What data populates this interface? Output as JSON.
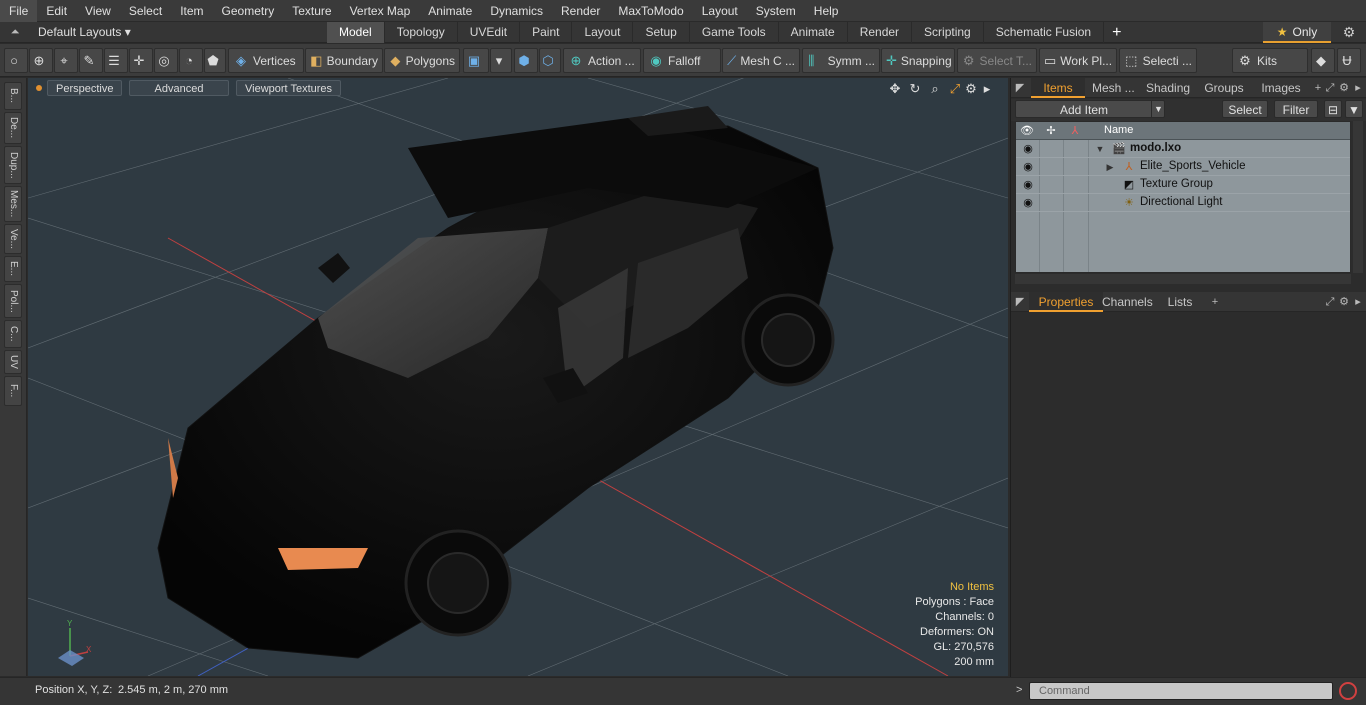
{
  "menu": [
    "File",
    "Edit",
    "View",
    "Select",
    "Item",
    "Geometry",
    "Texture",
    "Vertex Map",
    "Animate",
    "Dynamics",
    "Render",
    "MaxToModo",
    "Layout",
    "System",
    "Help"
  ],
  "layout_select": "Default Layouts ▾",
  "mode_tabs": [
    "Model",
    "Topology",
    "UVEdit",
    "Paint",
    "Layout",
    "Setup",
    "Game Tools",
    "Animate",
    "Render",
    "Scripting",
    "Schematic Fusion"
  ],
  "active_mode_tab": "Model",
  "only_label": "Only",
  "toolbar": {
    "vertices": "Vertices",
    "boundary": "Boundary",
    "polygons": "Polygons",
    "action": "Action ...",
    "falloff": "Falloff",
    "mesh": "Mesh C ...",
    "symm": "Symm ...",
    "snapping": "Snapping",
    "select_t": "Select T...",
    "work_pl": "Work Pl...",
    "selecti": "Selecti ...",
    "kits": "Kits"
  },
  "left_tabs": [
    "B...",
    "De...",
    "Dup...",
    "Mes...",
    "Ve...",
    "E...",
    "Pol...",
    "C...",
    "UV",
    "F..."
  ],
  "viewport": {
    "perspective": "Perspective",
    "advanced": "Advanced",
    "viewport_textures": "Viewport Textures",
    "info": {
      "no_items": "No Items",
      "polygons": "Polygons : Face",
      "channels": "Channels: 0",
      "deformers": "Deformers: ON",
      "gl": "GL: 270,576",
      "scale": "200 mm"
    }
  },
  "status": {
    "position_label": "Position X, Y, Z:",
    "position_value": "2.545 m, 2 m, 270 mm"
  },
  "right_panel": {
    "top_tabs": [
      "Items",
      "Mesh ...",
      "Shading",
      "Groups",
      "Images"
    ],
    "add_item": "Add Item",
    "select_btn": "Select",
    "filter_btn": "Filter",
    "tree_header_name": "Name",
    "tree": [
      {
        "label": "modo.lxo",
        "bold": true
      },
      {
        "label": "Elite_Sports_Vehicle"
      },
      {
        "label": "Texture Group"
      },
      {
        "label": "Directional Light"
      }
    ],
    "bottom_tabs": [
      "Properties",
      "Channels",
      "Lists"
    ],
    "command_placeholder": "Command"
  },
  "colors": {
    "accent": "#f0a030",
    "viewport_bg": "#2f3a42",
    "tree_bg": "#8e979c"
  }
}
